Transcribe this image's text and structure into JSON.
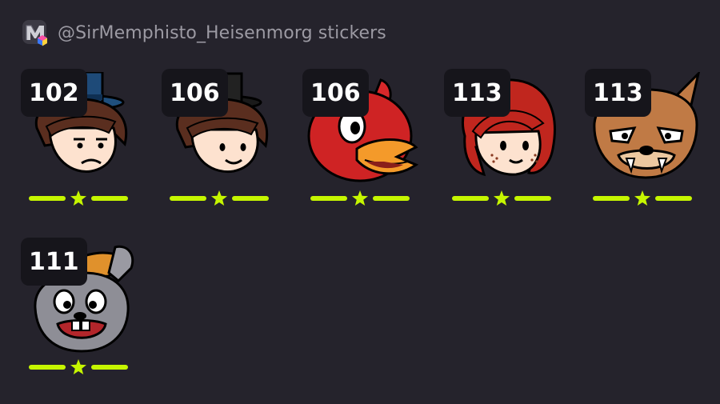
{
  "header": {
    "channel_avatar_icon": "channel-logo-icon",
    "title": "@SirMemphisto_Heisenmorg stickers"
  },
  "colors": {
    "background": "#25232c",
    "badge_background": "#16151b",
    "rating_accent": "#c6f600",
    "header_text": "#9c9aa3"
  },
  "stickers": [
    {
      "count": "102",
      "icon": "boy-top-hat-sticker-icon",
      "rating_icon": "star-icon"
    },
    {
      "count": "106",
      "icon": "smiling-boy-top-hat-sticker-icon",
      "rating_icon": "star-icon"
    },
    {
      "count": "106",
      "icon": "red-bird-sticker-icon",
      "rating_icon": "star-icon"
    },
    {
      "count": "113",
      "icon": "freckled-girl-sticker-icon",
      "rating_icon": "star-icon"
    },
    {
      "count": "113",
      "icon": "werewolf-sticker-icon",
      "rating_icon": "star-icon"
    },
    {
      "count": "111",
      "icon": "gray-rabbit-sticker-icon",
      "rating_icon": "star-icon"
    }
  ]
}
